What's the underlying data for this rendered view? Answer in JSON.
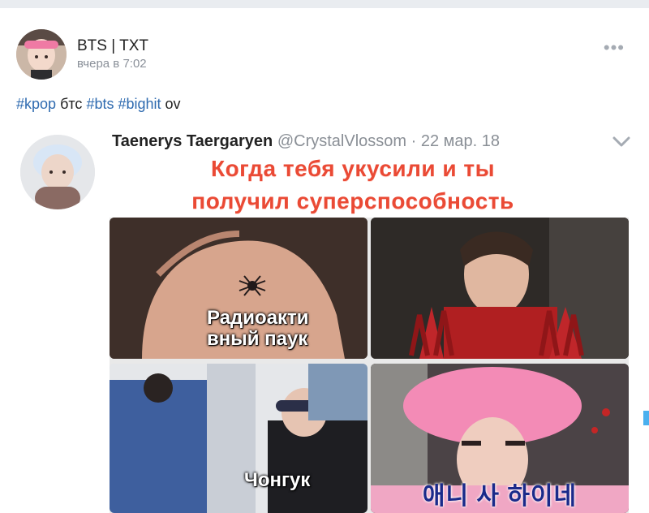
{
  "post": {
    "author": "BTS | TXT",
    "time": "вчера в 7:02",
    "text_parts": [
      "#kpop",
      "бтс",
      "#bts",
      "#bighit",
      "ov"
    ]
  },
  "tweet": {
    "name": "Taenerys Taergaryen",
    "handle": "@CrystalVlossom · 22 мар. 18"
  },
  "meme": {
    "title_line1": "Когда тебя укусили и ты",
    "title_line2": "получил суперспособность",
    "caption_spider_1": "Радиоакти",
    "caption_spider_2": "вный паук",
    "caption_person": "Чонгук",
    "caption_korean": "애니 사 하이네"
  },
  "icons": {
    "more": "more-dots-icon",
    "chevron": "chevron-down-icon"
  },
  "colors": {
    "hashtag": "#2f6bb0",
    "meme_title": "#ea4a35"
  }
}
